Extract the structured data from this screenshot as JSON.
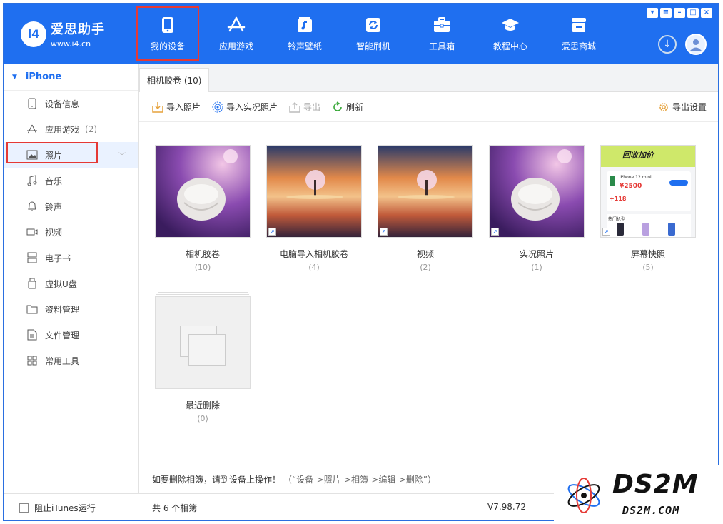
{
  "app": {
    "title": "爱思助手",
    "url": "www.i4.cn",
    "logo_mark": "i4"
  },
  "nav": [
    {
      "label": "我的设备",
      "icon": "phone-icon",
      "active": true
    },
    {
      "label": "应用游戏",
      "icon": "appstore-icon",
      "active": false
    },
    {
      "label": "铃声壁纸",
      "icon": "music-note-icon",
      "active": false
    },
    {
      "label": "智能刷机",
      "icon": "refresh-box-icon",
      "active": false
    },
    {
      "label": "工具箱",
      "icon": "toolbox-icon",
      "active": false
    },
    {
      "label": "教程中心",
      "icon": "graduation-cap-icon",
      "active": false
    },
    {
      "label": "爱思商城",
      "icon": "shop-icon",
      "active": false
    }
  ],
  "sidebar": {
    "device": "iPhone",
    "items": [
      {
        "label": "设备信息",
        "icon": "device-info-icon",
        "count": ""
      },
      {
        "label": "应用游戏",
        "icon": "appstore-icon",
        "count": "(2)"
      },
      {
        "label": "照片",
        "icon": "photo-icon",
        "count": "",
        "active": true
      },
      {
        "label": "音乐",
        "icon": "music-icon",
        "count": ""
      },
      {
        "label": "铃声",
        "icon": "bell-icon",
        "count": ""
      },
      {
        "label": "视频",
        "icon": "video-icon",
        "count": ""
      },
      {
        "label": "电子书",
        "icon": "ebook-icon",
        "count": ""
      },
      {
        "label": "虚拟U盘",
        "icon": "usb-drive-icon",
        "count": ""
      },
      {
        "label": "资料管理",
        "icon": "folder-icon",
        "count": ""
      },
      {
        "label": "文件管理",
        "icon": "file-icon",
        "count": ""
      },
      {
        "label": "常用工具",
        "icon": "grid-tools-icon",
        "count": ""
      }
    ]
  },
  "tab": {
    "label": "相机胶卷 (10)"
  },
  "toolbar": {
    "import_photos": "导入照片",
    "import_live": "导入实况照片",
    "export": "导出",
    "refresh": "刷新",
    "export_settings": "导出设置"
  },
  "albums": [
    {
      "name": "相机胶卷",
      "count": "(10)",
      "thumb": "airpods"
    },
    {
      "name": "电脑导入相机胶卷",
      "count": "(4)",
      "thumb": "sunset-tree"
    },
    {
      "name": "视频",
      "count": "(2)",
      "thumb": "sunset-tree"
    },
    {
      "name": "实况照片",
      "count": "(1)",
      "thumb": "airpods"
    },
    {
      "name": "屏幕快照",
      "count": "(5)",
      "thumb": "screenshot"
    },
    {
      "name": "最近删除",
      "count": "(0)",
      "thumb": "empty"
    }
  ],
  "screenshot_thumb": {
    "banner": "回收加价",
    "model": "iPhone 12 mini",
    "price": "¥2500",
    "bonus": "+118",
    "section": "热门机型"
  },
  "hint": {
    "text": "如要删除相簿，请到设备上操作！",
    "path": "（“设备->照片->相簿->编辑->删除”）"
  },
  "status": {
    "block_itunes": "阻止iTunes运行",
    "albums_total": "共 6 个相簿",
    "version": "V7.98.72"
  },
  "watermark": {
    "brand": "DS2M",
    "url": "DS2M.COM"
  },
  "colors": {
    "brand_blue": "#1f6ff0",
    "highlight_red": "#e53935"
  }
}
